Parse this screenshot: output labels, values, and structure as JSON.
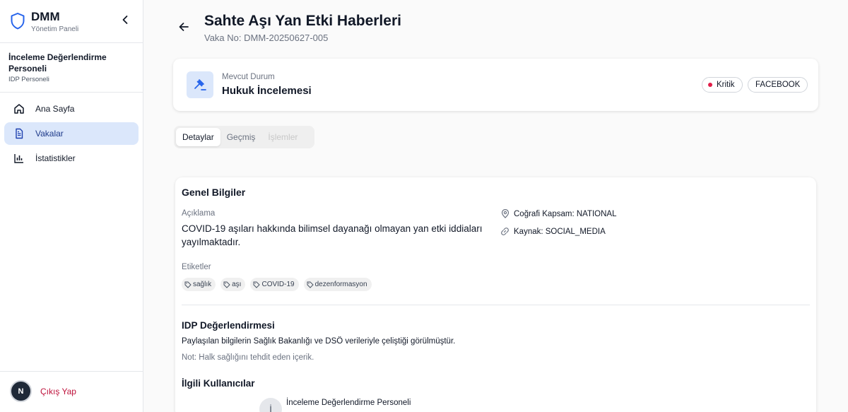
{
  "brand": {
    "title": "DMM",
    "subtitle": "Yönetim Paneli",
    "icon": "shield-icon",
    "accent": "#1e40af"
  },
  "sidebar": {
    "user": {
      "name": "İnceleme Değerlendirme Personeli",
      "role": "IDP Personeli"
    },
    "items": [
      {
        "label": "Ana Sayfa",
        "icon": "home-icon",
        "active": false
      },
      {
        "label": "Vakalar",
        "icon": "document-icon",
        "active": true
      },
      {
        "label": "İstatistikler",
        "icon": "bar-chart-icon",
        "active": false
      }
    ],
    "logout": {
      "avatar_letter": "N",
      "label": "Çıkış Yap",
      "color": "#be123c"
    }
  },
  "header": {
    "title": "Sahte Aşı Yan Etki Haberleri",
    "case_no": "Vaka No: DMM-20250627-005"
  },
  "status": {
    "label": "Mevcut Durum",
    "value": "Hukuk İncelemesi",
    "icon": "gavel-icon",
    "priority": "Kritik",
    "priority_color": "#e11d48",
    "platform": "FACEBOOK"
  },
  "tabs": [
    {
      "label": "Detaylar",
      "state": "active"
    },
    {
      "label": "Geçmiş",
      "state": "inactive"
    },
    {
      "label": "İşlemler",
      "state": "disabled"
    }
  ],
  "details": {
    "title": "Genel Bilgiler",
    "description_label": "Açıklama",
    "description": "COVID-19 aşıları hakkında bilimsel dayanağı olmayan yan etki iddiaları yayılmaktadır.",
    "geo": "Coğrafi Kapsam: NATIONAL",
    "source": "Kaynak: SOCIAL_MEDIA",
    "tags_label": "Etiketler",
    "tags": [
      "sağlık",
      "aşı",
      "COVID-19",
      "dezenformasyon"
    ],
    "idp_title": "IDP Değerlendirmesi",
    "idp_text": "Paylaşılan bilgilerin Sağlık Bakanlığı ve DSÖ verileriyle çeliştiği görülmüştür.",
    "idp_note": "Not: Halk sağlığını tehdit eden içerik.",
    "related_title": "İlgili Kullanıcılar",
    "related_user": {
      "avatar_letter": "İ",
      "name": "İnceleme Değerlendirme Personeli"
    }
  }
}
